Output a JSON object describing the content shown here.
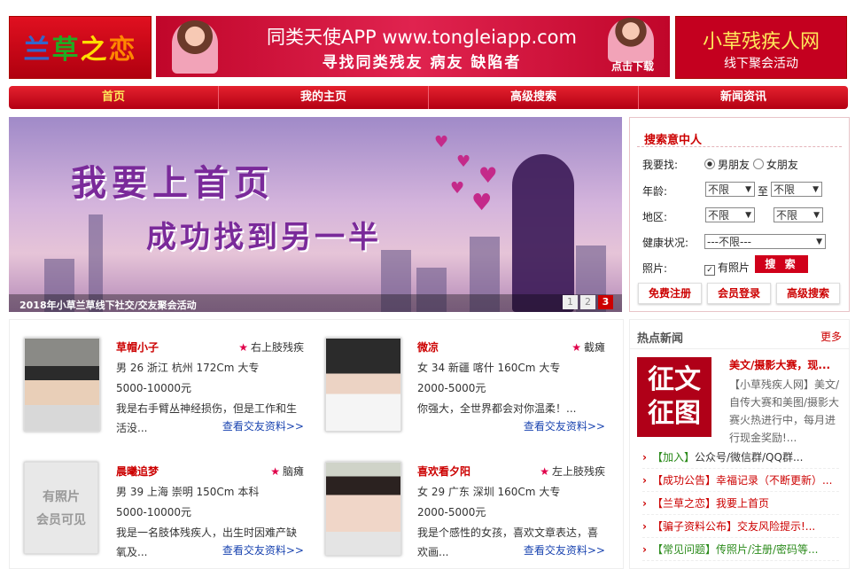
{
  "header": {
    "logo": "兰草之恋",
    "banner_title": "同类天使APP www.tongleiapp.com",
    "banner_sub": "寻找同类残友 病友 缺陷者",
    "banner_download": "点击下载",
    "ad_title": "小草残疾人网",
    "ad_sub": "线下聚会活动"
  },
  "nav": [
    "首页",
    "我的主页",
    "高级搜索",
    "新闻资讯"
  ],
  "slider": {
    "line1": "我要上首页",
    "line2": "成功找到另一半",
    "caption": "2018年小草兰草线下社交/交友聚会活动",
    "pages": [
      "1",
      "2",
      "3"
    ],
    "active_page": "3"
  },
  "search": {
    "title": "搜索意中人",
    "find_label": "我要找:",
    "opt_boy": "男朋友",
    "opt_girl": "女朋友",
    "age_label": "年龄:",
    "age_from": "不限",
    "age_to_word": "至",
    "age_to": "不限",
    "region_label": "地区:",
    "region1": "不限",
    "region2": "不限",
    "health_label": "健康状况:",
    "health_value": "---不限---",
    "photo_label": "照片:",
    "has_photo": "有照片",
    "search_btn": "搜 索",
    "register_btn": "免费注册",
    "login_btn": "会员登录",
    "advanced_btn": "高级搜索"
  },
  "members": [
    {
      "name": "草帽小子",
      "tag": "右上肢残疾",
      "info": "男 26 浙江 杭州 172Cm 大专",
      "income": "5000-10000元",
      "intro": "我是右手臂丛神经损伤，但是工作和生活没...",
      "more": "查看交友资料>>"
    },
    {
      "name": "微凉",
      "tag": "截瘫",
      "info": "女 34 新疆 喀什 160Cm 大专",
      "income": "2000-5000元",
      "intro": "你强大，全世界都会对你温柔！...",
      "more": "查看交友资料>>"
    },
    {
      "name": "晨曦追梦",
      "tag": "脑瘫",
      "info": "男 39 上海 崇明 150Cm 本科",
      "income": "5000-10000元",
      "intro": "我是一名肢体残疾人，出生时因难产缺氧及...",
      "more": "查看交友资料>>",
      "nophoto": "有照片\n会员可见"
    },
    {
      "name": "喜欢看夕阳",
      "tag": "左上肢残疾",
      "info": "女 29 广东 深圳 160Cm 大专",
      "income": "2000-5000元",
      "intro": "我是个感性的女孩，喜欢文章表达，喜欢画...",
      "more": "查看交友资料>>"
    }
  ],
  "nophoto_line1": "有照片",
  "nophoto_line2": "会员可见",
  "news": {
    "title": "热点新闻",
    "more": "更多",
    "feature_img_text1": "征文",
    "feature_img_text2": "征图",
    "feature_title": "美文/摄影大赛，现...",
    "feature_body": "【小草残疾人网】美文/自传大赛和美图/摄影大赛火热进行中，每月进行现金奖励!...",
    "items": [
      {
        "bracket": "【加入】",
        "text": "公众号/微信群/QQ群..."
      },
      {
        "bracket": "【成功公告】",
        "text": "幸福记录（不断更新）..."
      },
      {
        "bracket": "【兰草之恋】",
        "text": "我要上首页"
      },
      {
        "bracket": "【骗子资料公布】",
        "text": "交友风险提示!..."
      },
      {
        "bracket": "【常见问题】",
        "text": "传照片/注册/密码等..."
      }
    ]
  }
}
